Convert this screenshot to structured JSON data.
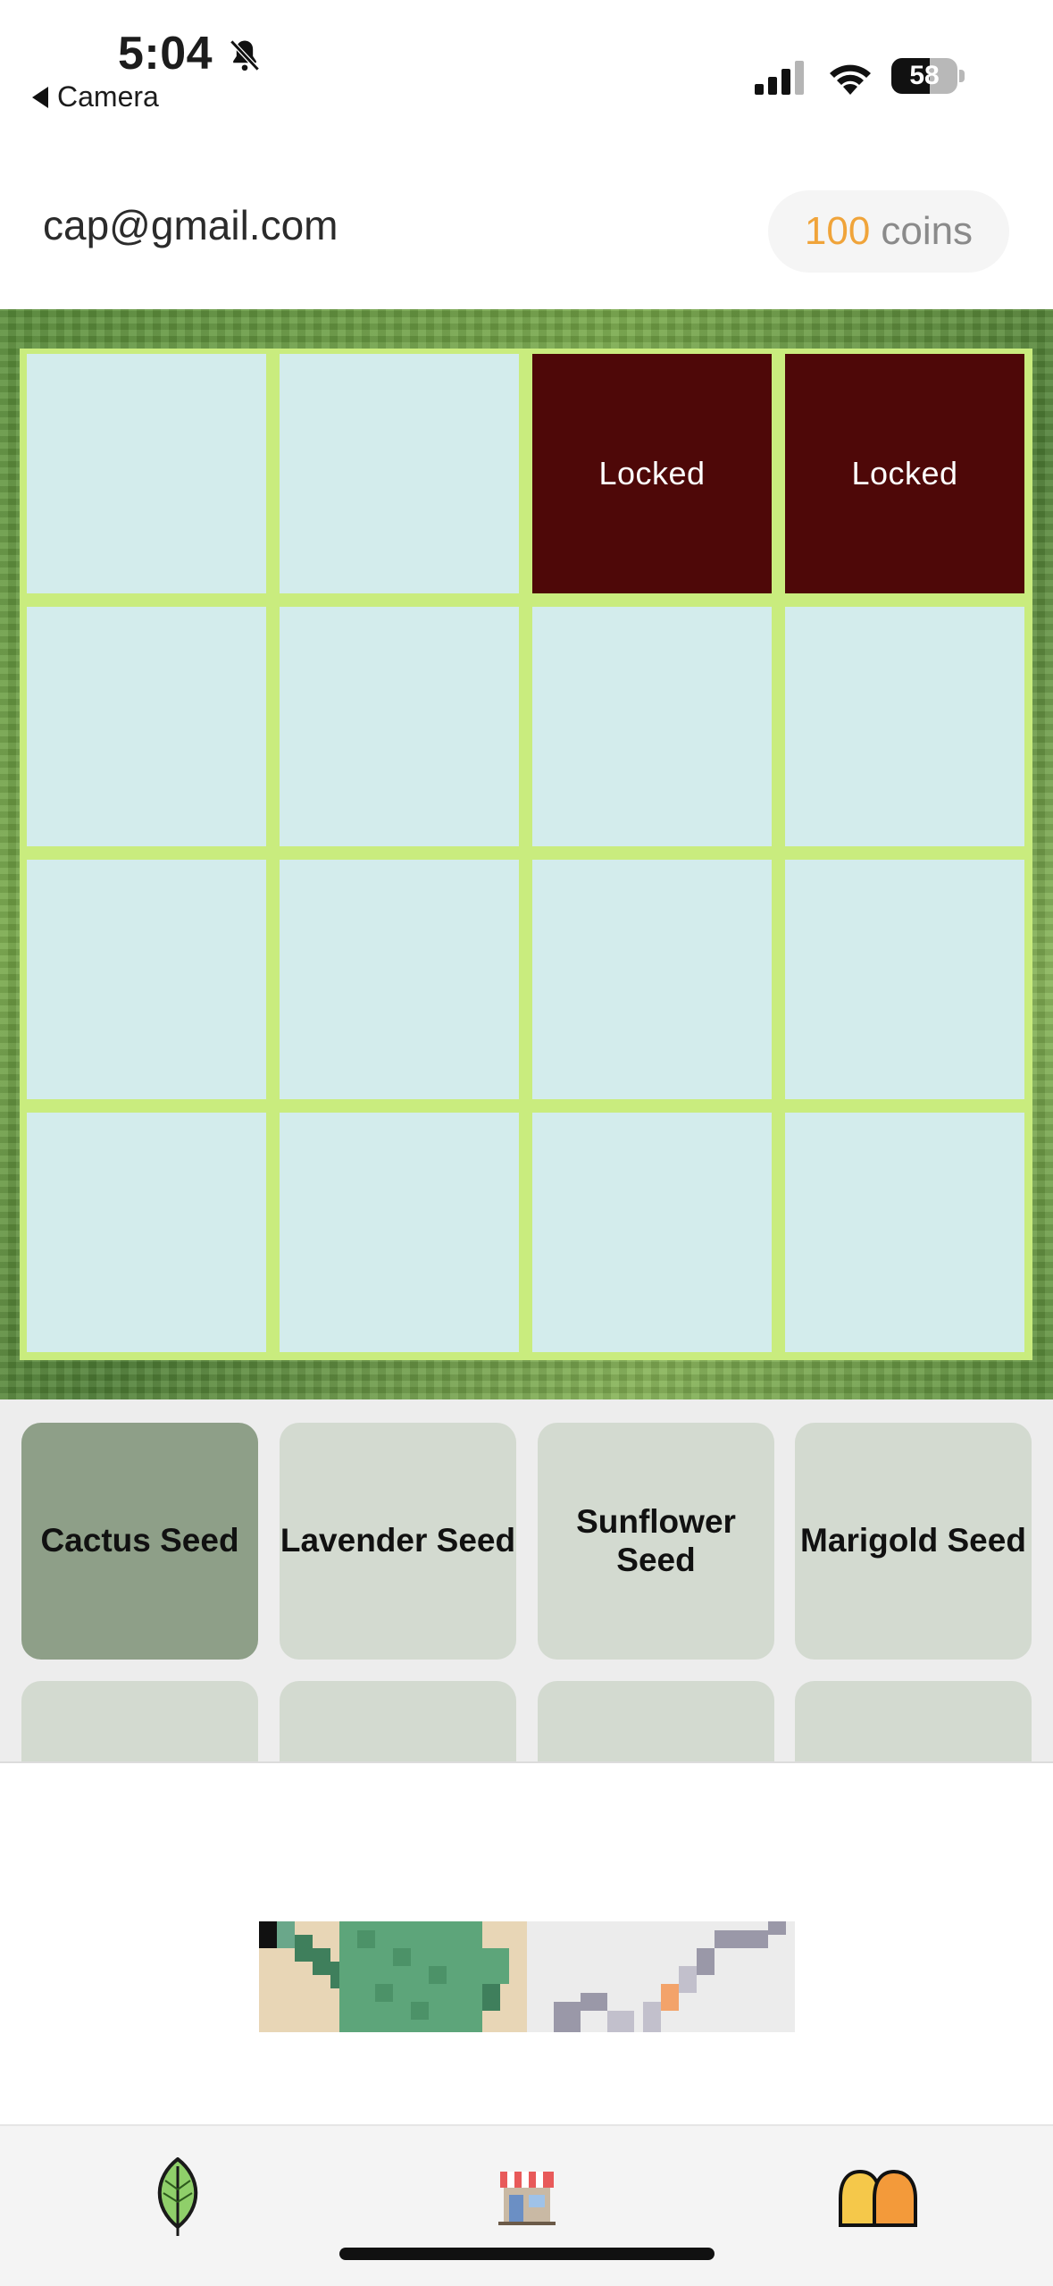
{
  "status_bar": {
    "time": "5:04",
    "back_label": "Camera",
    "battery_level": "58",
    "icons": [
      "bell-slash-icon",
      "signal-icon",
      "wifi-icon",
      "battery-icon"
    ]
  },
  "header": {
    "email": "cap@gmail.com",
    "coins_amount": "100",
    "coins_label": "coins"
  },
  "garden": {
    "plots": [
      {
        "label": ""
      },
      {
        "label": ""
      },
      {
        "label": "Locked"
      },
      {
        "label": "Locked"
      },
      {
        "label": ""
      },
      {
        "label": ""
      },
      {
        "label": ""
      },
      {
        "label": ""
      },
      {
        "label": ""
      },
      {
        "label": ""
      },
      {
        "label": ""
      },
      {
        "label": ""
      },
      {
        "label": ""
      },
      {
        "label": ""
      },
      {
        "label": ""
      },
      {
        "label": ""
      }
    ]
  },
  "seeds": {
    "items": [
      {
        "label": "Cactus Seed",
        "selected": true
      },
      {
        "label": "Lavender Seed",
        "selected": false
      },
      {
        "label": "Sunflower Seed",
        "selected": false
      },
      {
        "label": "Marigold Seed",
        "selected": false
      }
    ]
  },
  "tabs": [
    {
      "icon": "leaf-icon"
    },
    {
      "icon": "shop-icon"
    },
    {
      "icon": "friends-icon"
    }
  ],
  "colors": {
    "coins_accent": "#f0a43a",
    "locked_plot": "#4e0808",
    "empty_plot": "#d3ecec",
    "seed_selected": "#8e9f88",
    "seed_default": "#d3dad0"
  }
}
